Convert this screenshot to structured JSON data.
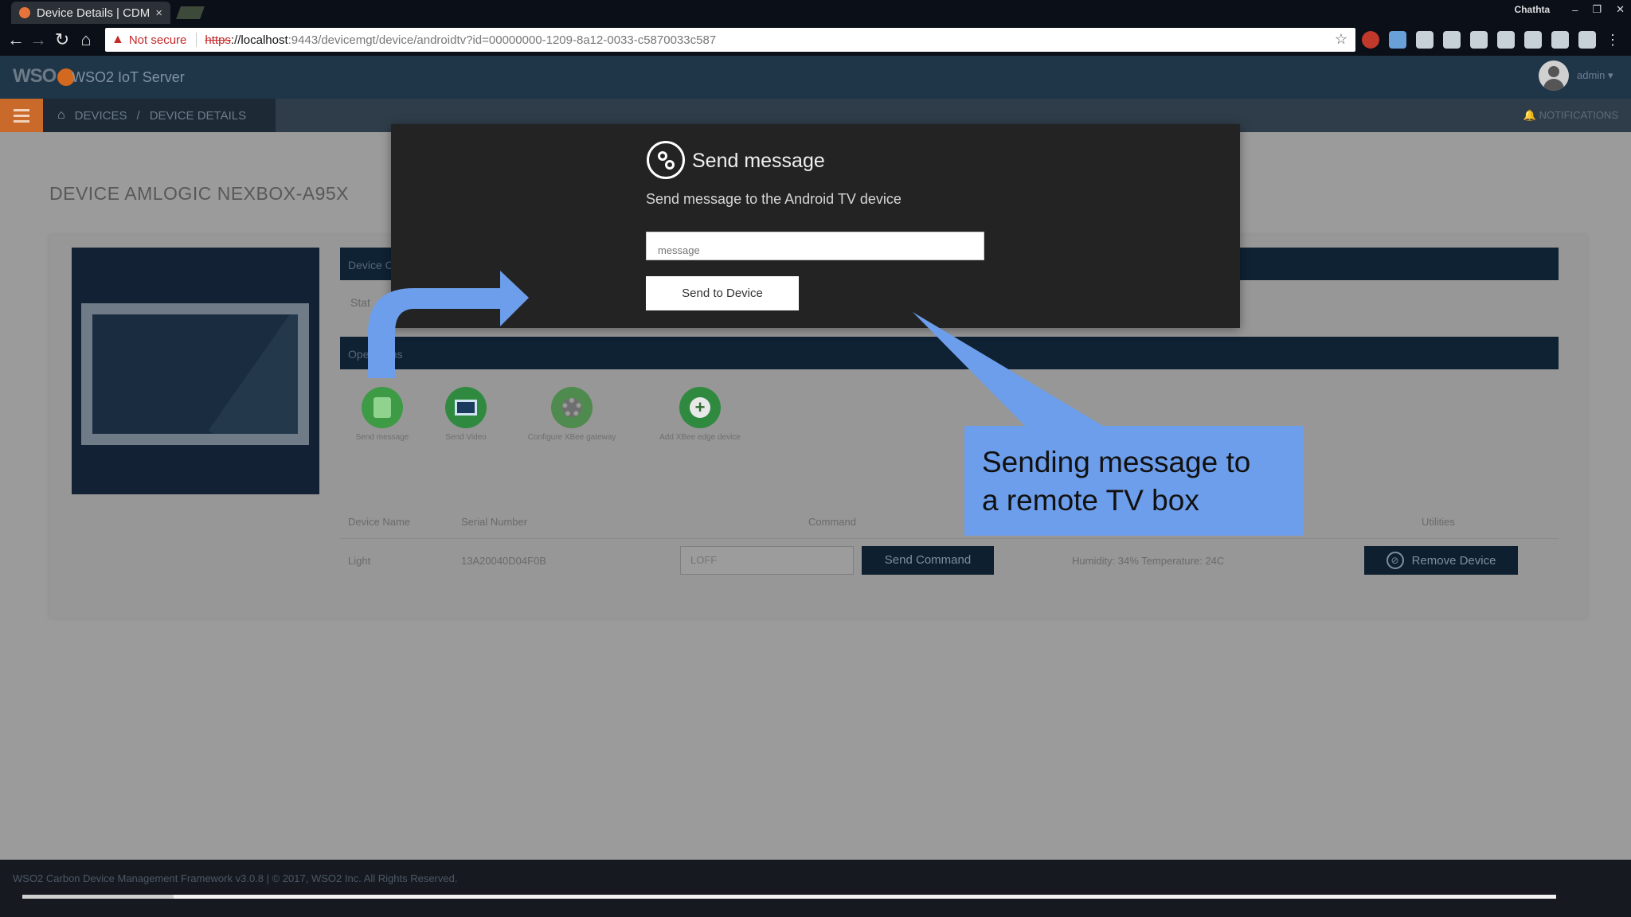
{
  "browser": {
    "tab_title": "Device Details | CDM",
    "tab_close": "×",
    "window_user": "Chathta",
    "window_controls": [
      "–",
      "❐",
      "✕"
    ],
    "address": {
      "security_label": "Not secure",
      "scheme": "https",
      "host": "://localhost",
      "path": ":9443/devicemgt/device/androidtv?id=00000000-1209-8a12-0033-c5870033c587"
    },
    "nav_icons": [
      "back-icon",
      "forward-icon",
      "reload-icon",
      "home-icon"
    ]
  },
  "app": {
    "logo_text": "WSO",
    "title": "WSO2 IoT Server",
    "user_label": "admin ▾"
  },
  "breadcrumb": {
    "items": [
      "DEVICES",
      "DEVICE DETAILS"
    ],
    "separator": "/"
  },
  "notifications_label": "NOTIFICATIONS",
  "page": {
    "title": "DEVICE AMLOGIC NEXBOX-A95X",
    "device_section_header": "Device C",
    "status_label": "Stat",
    "operations_header": "Operations",
    "operations": [
      {
        "label": "Send message",
        "color": "#3d9a45",
        "icon": "message-icon"
      },
      {
        "label": "Send Video",
        "color": "#2f8a40",
        "icon": "monitor-icon"
      },
      {
        "label": "Configure XBee gateway",
        "color": "#4f8a4f",
        "icon": "gear-icon"
      },
      {
        "label": "Add XBee edge device",
        "color": "#2f8a40",
        "icon": "plus-icon"
      }
    ],
    "table": {
      "headers": [
        "Device Name",
        "Serial Number",
        "Command",
        "Utilities"
      ],
      "row": {
        "device_name": "Light",
        "serial": "13A20040D04F0B",
        "command_value": "LOFF",
        "send_label": "Send Command",
        "status": "Humidity: 34% Temperature: 24C",
        "remove_label": "Remove Device"
      }
    }
  },
  "modal": {
    "title": "Send message",
    "subtitle": "Send message to the Android TV device",
    "input_placeholder": "message",
    "button_label": "Send to Device"
  },
  "annotation": {
    "line1": "Sending message to",
    "line2": "a remote TV box",
    "color": "#6d9eeb"
  },
  "footer": {
    "text": "WSO2 Carbon Device Management Framework v3.0.8 | © 2017, WSO2 Inc. All Rights Reserved."
  }
}
